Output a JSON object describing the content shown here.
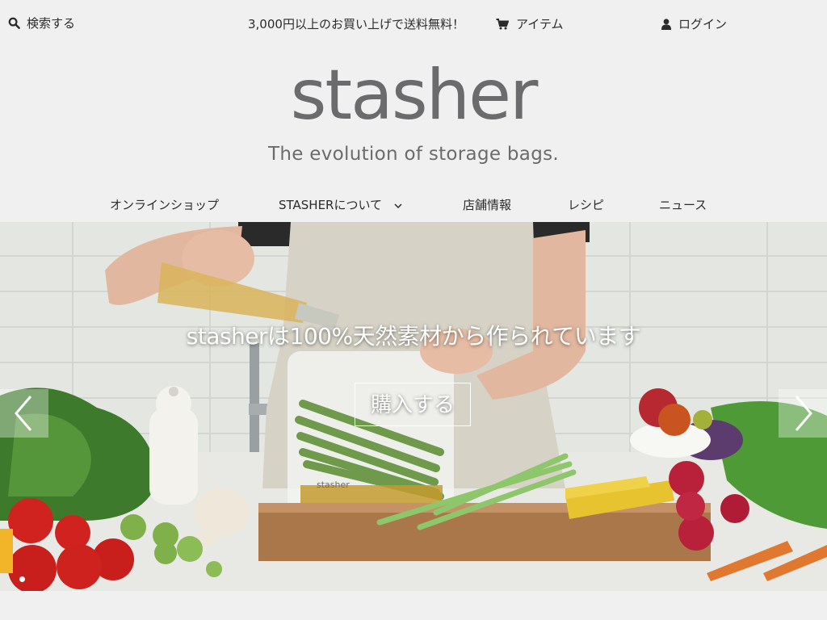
{
  "header": {
    "search_label": "検索する",
    "search_icon": "search-icon",
    "promo_text": "3,000円以上のお買い上げで送料無料！",
    "cart_label": "アイテム",
    "cart_icon": "cart-icon",
    "login_label": "ログイン",
    "login_icon": "user-icon"
  },
  "brand": {
    "logo_text": "stasher",
    "tagline": "The evolution of storage bags.",
    "logo_color": "#6b6b6d"
  },
  "nav": {
    "items": [
      {
        "label": "オンラインショップ"
      },
      {
        "label": "STASHERについて",
        "has_dropdown": true
      },
      {
        "label": "店舗情報"
      },
      {
        "label": "レシピ"
      },
      {
        "label": "ニュース"
      }
    ]
  },
  "hero": {
    "headline": "stasherは100%天然素材から作られています",
    "cta_label": "購入する",
    "prev_icon": "chevron-left-icon",
    "next_icon": "chevron-right-icon",
    "bag_logo_text": "stasher",
    "slide_count_visible": 1
  }
}
